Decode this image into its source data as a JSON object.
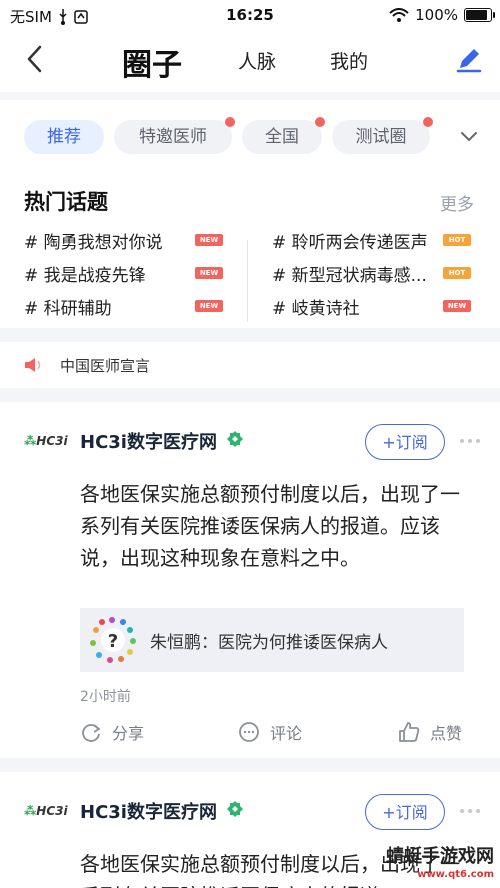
{
  "status_bar": {
    "carrier": "无SIM",
    "time": "16:25",
    "battery": "100%",
    "battery_level": 1.0
  },
  "nav": {
    "title": "圈子",
    "tabs": [
      "人脉",
      "我的"
    ],
    "back_icon": "back-chevron-icon",
    "edit_icon": "pencil-icon"
  },
  "categories": [
    {
      "label": "推荐",
      "active": true,
      "dot": false
    },
    {
      "label": "特邀医师",
      "active": false,
      "dot": true
    },
    {
      "label": "全国",
      "active": false,
      "dot": true
    },
    {
      "label": "测试圈",
      "active": false,
      "dot": true
    }
  ],
  "hot": {
    "title": "热门话题",
    "more": "更多",
    "left": [
      {
        "label": "# 陶勇我想对你说",
        "badge": "NEW"
      },
      {
        "label": "# 我是战疫先锋",
        "badge": "NEW"
      },
      {
        "label": "# 科研辅助",
        "badge": "NEW"
      }
    ],
    "right": [
      {
        "label": "# 聆听两会传递医声",
        "badge": "HOT"
      },
      {
        "label": "# 新型冠状病毒感...",
        "badge": "HOT"
      },
      {
        "label": "# 岐黄诗社",
        "badge": "NEW"
      }
    ]
  },
  "notice": {
    "text": "中国医师宣言"
  },
  "posts": [
    {
      "logo": "HC3i",
      "author": "HC3i数字医疗网",
      "subscribe": "+订阅",
      "body": "各地医保实施总额预付制度以后，出现了一系列有关医院推诿医保病人的报道。应该说，出现这种现象在意料之中。",
      "link": "朱恒鹏：医院为何推诿医保病人",
      "time": "2小时前",
      "share": "分享",
      "comment": "评论",
      "like": "点赞"
    },
    {
      "logo": "HC3i",
      "author": "HC3i数字医疗网",
      "subscribe": "+订阅",
      "body": "各地医保实施总额预付制度以后，出现了一系列有关医院推诿医保病人的报道。"
    }
  ],
  "watermark": {
    "text": "蜻蜓手游戏网",
    "sub": "www.qt6.com"
  },
  "colors": {
    "accent": "#3a66e8",
    "new_badge": "#f4645f",
    "hot_badge": "#f5a43a",
    "verify": "#2fb46e"
  }
}
